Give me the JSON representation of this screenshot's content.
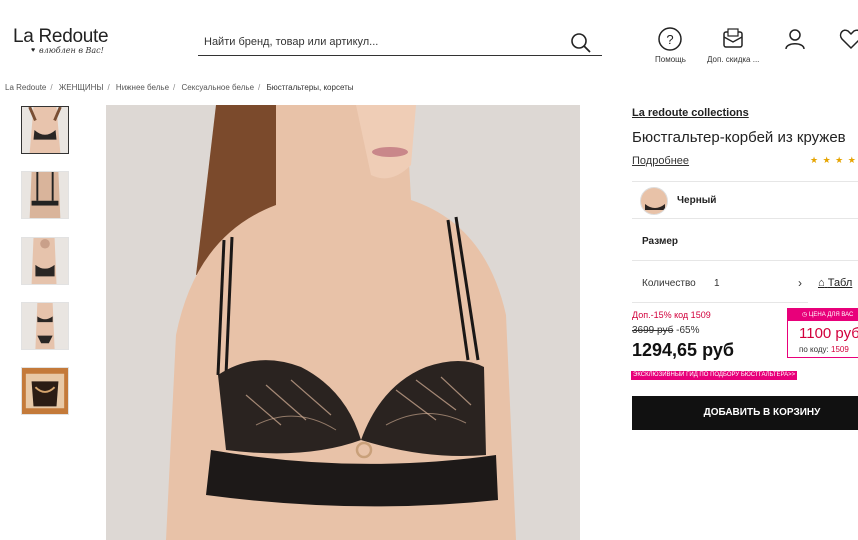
{
  "header": {
    "logo": "La Redoute",
    "tagline": "влюблен в Вас!",
    "search_placeholder": "Найти бренд, товар или артикул...",
    "help_label": "Помощь",
    "discount_label": "Доп. скидка ..."
  },
  "breadcrumb": [
    "La Redoute",
    "ЖЕНЩИНЫ",
    "Нижнее белье",
    "Сексуальное белье",
    "Бюстгальтеры, корсеты"
  ],
  "product": {
    "brand": "La redoute collections",
    "title": "Бюстгальтер-корбей из кружев",
    "more_link": "Подробнее",
    "rating_stars": "★ ★ ★ ★",
    "color_label": "Черный",
    "size_label": "Размер",
    "quantity_label": "Количество",
    "quantity_value": "1",
    "size_guide_label": "Табл",
    "promo_text": "Доп.-15% код 1509",
    "old_price": "3699 руб",
    "discount": "-65%",
    "current_price": "1294,65 руб",
    "deal_header": "ЦЕНА ДЛЯ ВАС",
    "deal_price": "1100 руб",
    "deal_code_label": "по коду:",
    "deal_code": "1509",
    "guide_link": "ЭКСКЛЮЗИВНЫЙ ГИД ПО ПОДБОРУ БЮСТГАЛЬТЕРА>>",
    "add_to_cart": "ДОБАВИТЬ В КОРЗИНУ"
  },
  "colors": {
    "accent": "#e8007a",
    "promo_red": "#d2003c",
    "button": "#111111",
    "stars": "#e6a400"
  }
}
